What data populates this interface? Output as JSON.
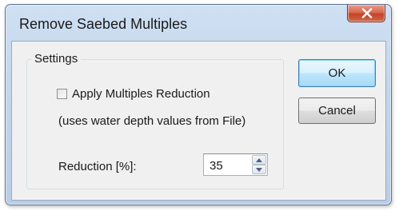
{
  "window": {
    "title": "Remove Saebed Multiples"
  },
  "settings": {
    "group_label": "Settings",
    "apply_multiples_label": "Apply Multiples Reduction",
    "apply_multiples_checked": false,
    "note": "(uses water depth values from File)",
    "reduction_label": "Reduction [%]:",
    "reduction_value": "35"
  },
  "buttons": {
    "ok_label": "OK",
    "cancel_label": "Cancel"
  },
  "icons": {
    "close": "close-icon",
    "spin_up": "arrow-up-icon",
    "spin_down": "arrow-down-icon"
  },
  "colors": {
    "title_bar": "#c3d6ec",
    "close_button": "#c4432a",
    "default_button_border": "#3c7fb1"
  }
}
